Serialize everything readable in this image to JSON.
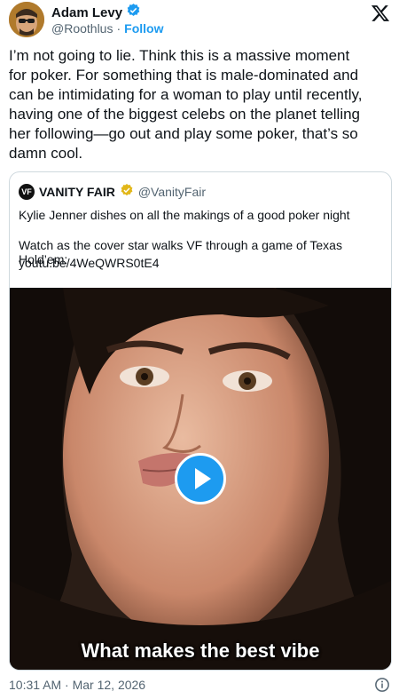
{
  "author": {
    "display_name": "Adam Levy",
    "handle": "@Roothlus",
    "separator": "·",
    "follow_label": "Follow"
  },
  "tweet": {
    "lines": [
      "I’m not going to lie. Think this is a massive moment",
      "for poker. For something that is male-dominated and",
      "can be intimidating for a woman to play until recently,",
      "having one of the biggest celebs on the planet telling",
      "her following—go out and play some poker, that’s so",
      "damn cool."
    ]
  },
  "quote": {
    "logo_text": "VF",
    "name": "VANITY FAIR",
    "handle": "@VanityFair",
    "line1": "Kylie Jenner dishes on all the makings of a good poker night",
    "line2": "Watch as the cover star walks VF through a game of Texas Hold’em:",
    "link": "youtu.be/4WeQWRS0tE4",
    "video_caption": "What makes the best vibe"
  },
  "footer": {
    "timestamp": "10:31 AM · Mar 12, 2026"
  },
  "colors": {
    "accent": "#1d9bf0",
    "text": "#0f1419",
    "muted": "#536471",
    "border": "#cfd9de",
    "gold_badge": "#e2b719"
  },
  "icons": [
    "verified-badge-icon",
    "x-logo-icon",
    "gold-verified-badge-icon",
    "play-icon",
    "info-icon"
  ]
}
